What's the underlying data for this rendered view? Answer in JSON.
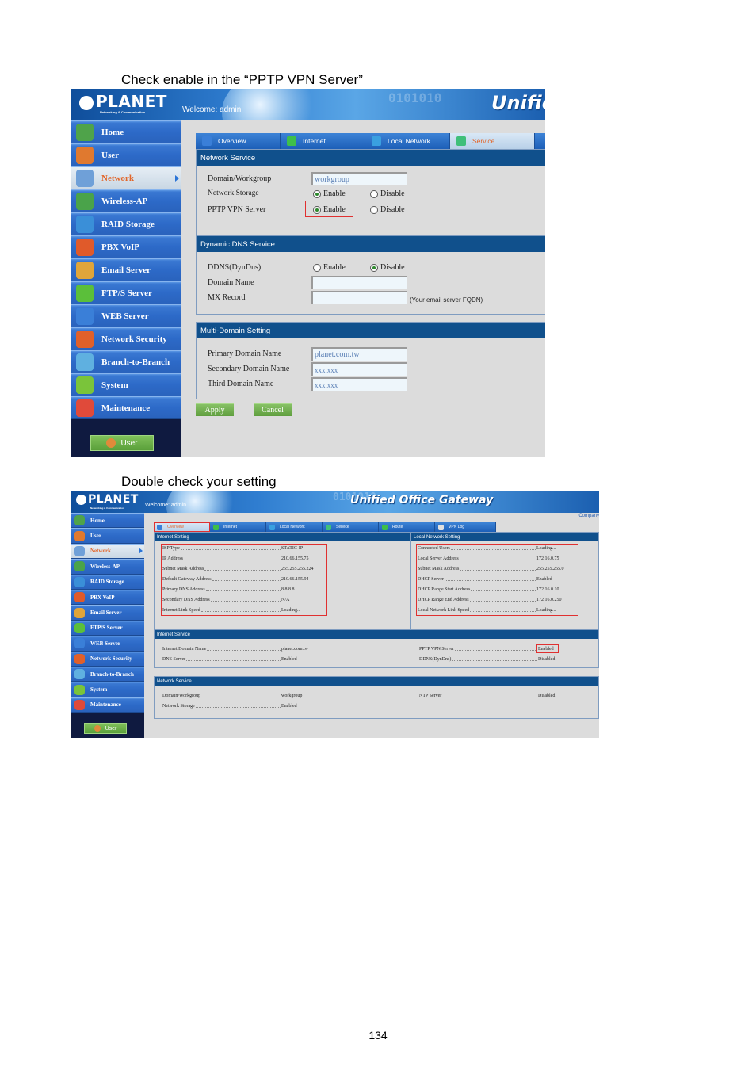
{
  "captions": {
    "step1": "Check enable in the “PPTP VPN Server”",
    "step2": "Double check your setting"
  },
  "page_number": "134",
  "shot1": {
    "banner": {
      "logo": "PLANET",
      "logo_sub": "Networking & Communication",
      "welcome": "Welcome: admin",
      "brand": "Unified",
      "digits": "0101010"
    },
    "sidebar": {
      "items": [
        {
          "label": "Home",
          "icon": "home-icon",
          "color": "#4fa34a"
        },
        {
          "label": "User",
          "icon": "user-icon",
          "color": "#e0792f"
        },
        {
          "label": "Network",
          "icon": "network-icon",
          "color": "#6fa0d8",
          "active": true
        },
        {
          "label": "Wireless-AP",
          "icon": "wireless-icon",
          "color": "#4aa34a"
        },
        {
          "label": "RAID Storage",
          "icon": "storage-icon",
          "color": "#3a8fd8"
        },
        {
          "label": "PBX VoIP",
          "icon": "phone-icon",
          "color": "#e05a2a"
        },
        {
          "label": "Email Server",
          "icon": "email-icon",
          "color": "#e0a53a"
        },
        {
          "label": "FTP/S Server",
          "icon": "folder-icon",
          "color": "#5bbf3a"
        },
        {
          "label": "WEB Server",
          "icon": "web-icon",
          "color": "#3a7fd8"
        },
        {
          "label": "Network Security",
          "icon": "security-icon",
          "color": "#e0602a"
        },
        {
          "label": "Branch-to-Branch",
          "icon": "branch-icon",
          "color": "#5fb0e0"
        },
        {
          "label": "System",
          "icon": "system-icon",
          "color": "#7ac43a"
        },
        {
          "label": "Maintenance",
          "icon": "tools-icon",
          "color": "#e04a3a"
        }
      ],
      "user_button": "User"
    },
    "tabs": [
      {
        "label": "Overview",
        "icon": "overview-icon"
      },
      {
        "label": "Internet",
        "icon": "globe-icon"
      },
      {
        "label": "Local Network",
        "icon": "monitor-icon"
      },
      {
        "label": "Service",
        "icon": "gears-icon",
        "active": true
      }
    ],
    "network_service": {
      "title": "Network Service",
      "domain_label": "Domain/Workgroup",
      "domain_value": "workgroup",
      "storage_label": "Network Storage",
      "storage_selected": "Enable",
      "pptp_label": "PPTP VPN Server",
      "pptp_selected": "Enable",
      "enable": "Enable",
      "disable": "Disable"
    },
    "ddns": {
      "title": "Dynamic DNS Service",
      "ddns_label": "DDNS(DynDns)",
      "ddns_selected": "Disable",
      "enable": "Enable",
      "disable": "Disable",
      "domain_label": "Domain Name",
      "domain_value": "",
      "mx_label": "MX Record",
      "mx_value": "",
      "mx_hint": "(Your email server FQDN)"
    },
    "multi_domain": {
      "title": "Multi-Domain Setting",
      "primary_label": "Primary Domain Name",
      "primary_value": "planet.com.tw",
      "secondary_label": "Secondary Domain Name",
      "secondary_value": "xxx.xxx",
      "third_label": "Third Domain Name",
      "third_value": "xxx.xxx"
    },
    "buttons": {
      "apply": "Apply",
      "cancel": "Cancel"
    }
  },
  "shot2": {
    "banner": {
      "logo": "PLANET",
      "logo_sub": "Networking & Communication",
      "welcome": "Welcome: admin",
      "brand": "Unified Office Gateway",
      "digits": "0101010"
    },
    "company_link": "Company",
    "sidebar": {
      "items": [
        {
          "label": "Home",
          "color": "#4fa34a"
        },
        {
          "label": "User",
          "color": "#e0792f"
        },
        {
          "label": "Network",
          "color": "#6fa0d8",
          "active": true
        },
        {
          "label": "Wireless-AP",
          "color": "#4aa34a"
        },
        {
          "label": "RAID Storage",
          "color": "#3a8fd8"
        },
        {
          "label": "PBX VoIP",
          "color": "#e05a2a"
        },
        {
          "label": "Email Server",
          "color": "#e0a53a"
        },
        {
          "label": "FTP/S Server",
          "color": "#5bbf3a"
        },
        {
          "label": "WEB Server",
          "color": "#3a7fd8"
        },
        {
          "label": "Network Security",
          "color": "#e0602a"
        },
        {
          "label": "Branch-to-Branch",
          "color": "#5fb0e0"
        },
        {
          "label": "System",
          "color": "#7ac43a"
        },
        {
          "label": "Maintenance",
          "color": "#e04a3a"
        }
      ],
      "user_button": "User"
    },
    "tabs": [
      {
        "label": "Overview",
        "active": true
      },
      {
        "label": "Internet"
      },
      {
        "label": "Local Network"
      },
      {
        "label": "Service"
      },
      {
        "label": "Route"
      },
      {
        "label": "VPN Log"
      }
    ],
    "internet_setting": {
      "title": "Internet Setting",
      "rows": [
        {
          "k": "ISP Type",
          "v": "STATIC-IP"
        },
        {
          "k": "IP Address",
          "v": "210.66.155.75"
        },
        {
          "k": "Subnet Mask Address",
          "v": "255.255.255.224"
        },
        {
          "k": "Default Gateway Address",
          "v": "210.66.155.94"
        },
        {
          "k": "Primary DNS Address",
          "v": "8.8.8.8"
        },
        {
          "k": "Secondary DNS Address",
          "v": "N/A"
        },
        {
          "k": "Internet Link Speed",
          "v": "Loading.."
        }
      ]
    },
    "local_setting": {
      "title": "Local Network Setting",
      "rows": [
        {
          "k": "Connected Users",
          "v": "Loading..."
        },
        {
          "k": "Local Server Address",
          "v": "172.16.0.75"
        },
        {
          "k": "Subnet Mask Address",
          "v": "255.255.255.0"
        },
        {
          "k": "DHCP Server",
          "v": "Enabled"
        },
        {
          "k": "DHCP Range Start Address",
          "v": "172.16.0.10"
        },
        {
          "k": "DHCP Range End Address",
          "v": "172.16.0.250"
        },
        {
          "k": "Local Network Link Speed",
          "v": "Loading..."
        }
      ]
    },
    "internet_service": {
      "title": "Internet Service",
      "left": [
        {
          "k": "Internet Domain Name",
          "v": "planet.com.tw"
        },
        {
          "k": "DNS Server",
          "v": "Enabled"
        }
      ],
      "right": [
        {
          "k": "PPTP VPN Server",
          "v": "Enabled"
        },
        {
          "k": "DDNS(DynDns)",
          "v": "Disabled"
        }
      ]
    },
    "network_service": {
      "title": "Network Service",
      "left": [
        {
          "k": "Domain/Workgroup",
          "v": "workgroup"
        },
        {
          "k": "Network Storage",
          "v": "Enabled"
        }
      ],
      "right": [
        {
          "k": "NTP Server",
          "v": "Disabled"
        }
      ]
    }
  }
}
